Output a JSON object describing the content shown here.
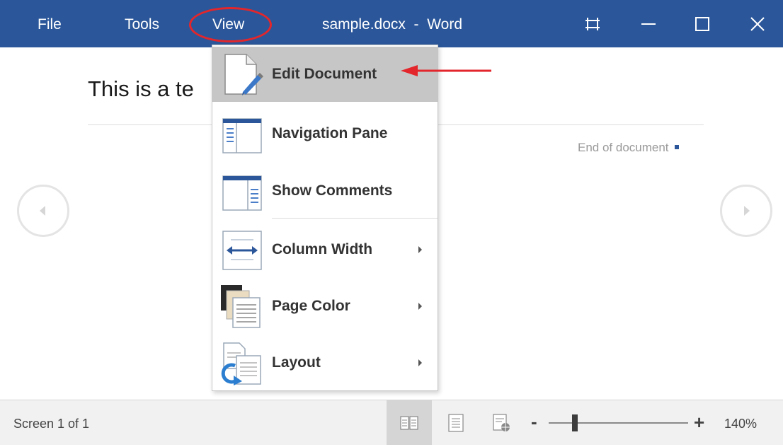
{
  "titlebar": {
    "menus": [
      "File",
      "Tools",
      "View"
    ],
    "document_title": "sample.docx  -  Word",
    "controls": [
      "fit-window-icon",
      "minimize-icon",
      "maximize-icon",
      "close-icon"
    ],
    "color": "#2b579a"
  },
  "document": {
    "heading_visible": "This is a te",
    "end_of_document": "End of document"
  },
  "view_menu": {
    "items": [
      {
        "label": "Edit Document",
        "icon": "edit-document-icon",
        "highlighted": true
      },
      {
        "label": "Navigation Pane",
        "icon": "navigation-pane-icon"
      },
      {
        "label": "Show Comments",
        "icon": "show-comments-icon"
      },
      {
        "label": "Column Width",
        "icon": "column-width-icon",
        "has_submenu": true
      },
      {
        "label": "Page Color",
        "icon": "page-color-icon",
        "has_submenu": true
      },
      {
        "label": "Layout",
        "icon": "layout-icon",
        "has_submenu": true
      }
    ]
  },
  "annotation": {
    "highlight_color": "#e3262b"
  },
  "statusbar": {
    "screen_info": "Screen 1 of 1",
    "zoom_minus": "-",
    "zoom_plus": "+",
    "zoom_level": "140%",
    "zoom_slider_fraction": 0.19
  }
}
